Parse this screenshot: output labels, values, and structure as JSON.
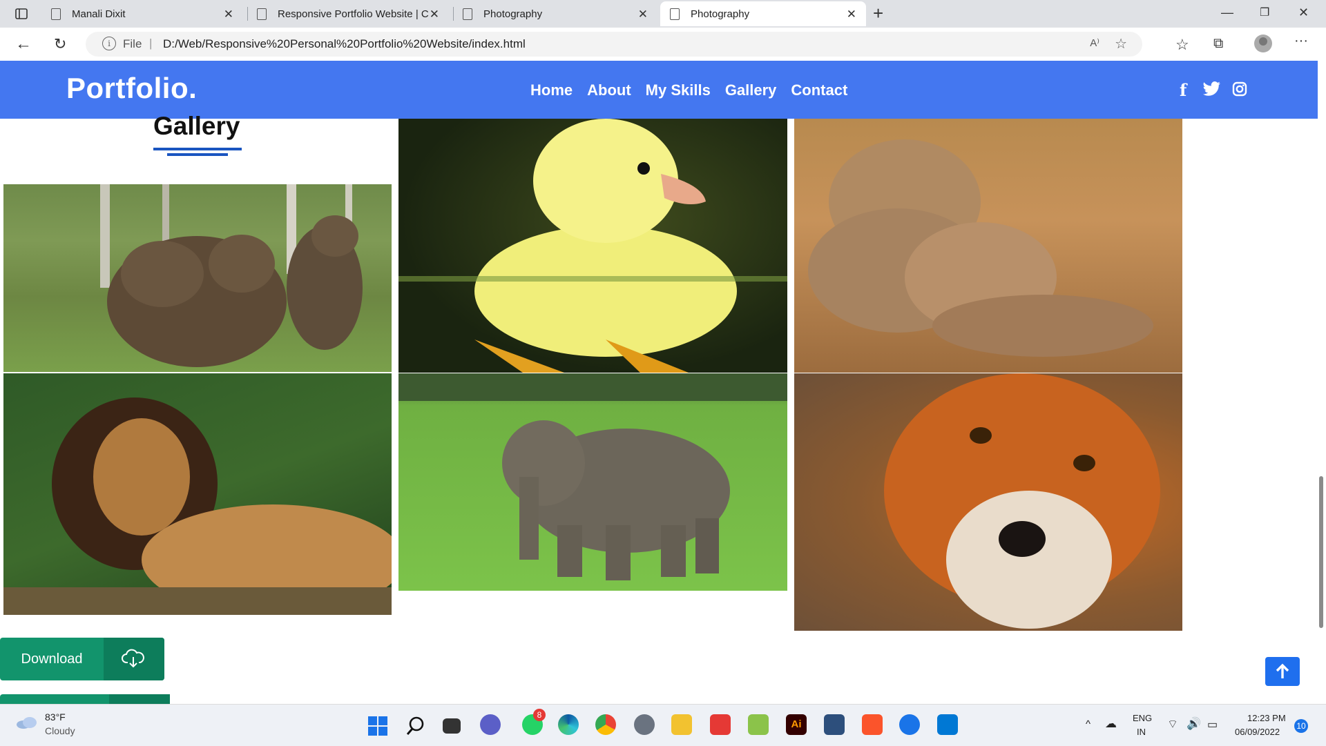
{
  "browser": {
    "tabs": [
      {
        "title": "Manali Dixit"
      },
      {
        "title": "Responsive Portfolio Website | C"
      },
      {
        "title": "Photography"
      },
      {
        "title": "Photography"
      }
    ],
    "url_scheme_label": "File",
    "url": "D:/Web/Responsive%20Personal%20Portfolio%20Website/index.html",
    "read_aloud_icon": "A⁾"
  },
  "site": {
    "logo": "Portfolio.",
    "nav": [
      "Home",
      "About",
      "My Skills",
      "Gallery",
      "Contact"
    ],
    "social": {
      "facebook": "f",
      "twitter": "twitter-icon",
      "instagram": "instagram-icon"
    },
    "accent": "#4477f0"
  },
  "gallery": {
    "title": "Gallery",
    "photos": [
      "bears",
      "duckling",
      "lions",
      "lion",
      "elephant",
      "fox"
    ]
  },
  "download": {
    "label": "Download"
  },
  "taskbar": {
    "weather_temp": "83°F",
    "weather_desc": "Cloudy",
    "whatsapp_badge": "8",
    "lang_top": "ENG",
    "lang_bottom": "IN",
    "time": "12:23 PM",
    "date": "06/09/2022",
    "notif_count": "10"
  }
}
